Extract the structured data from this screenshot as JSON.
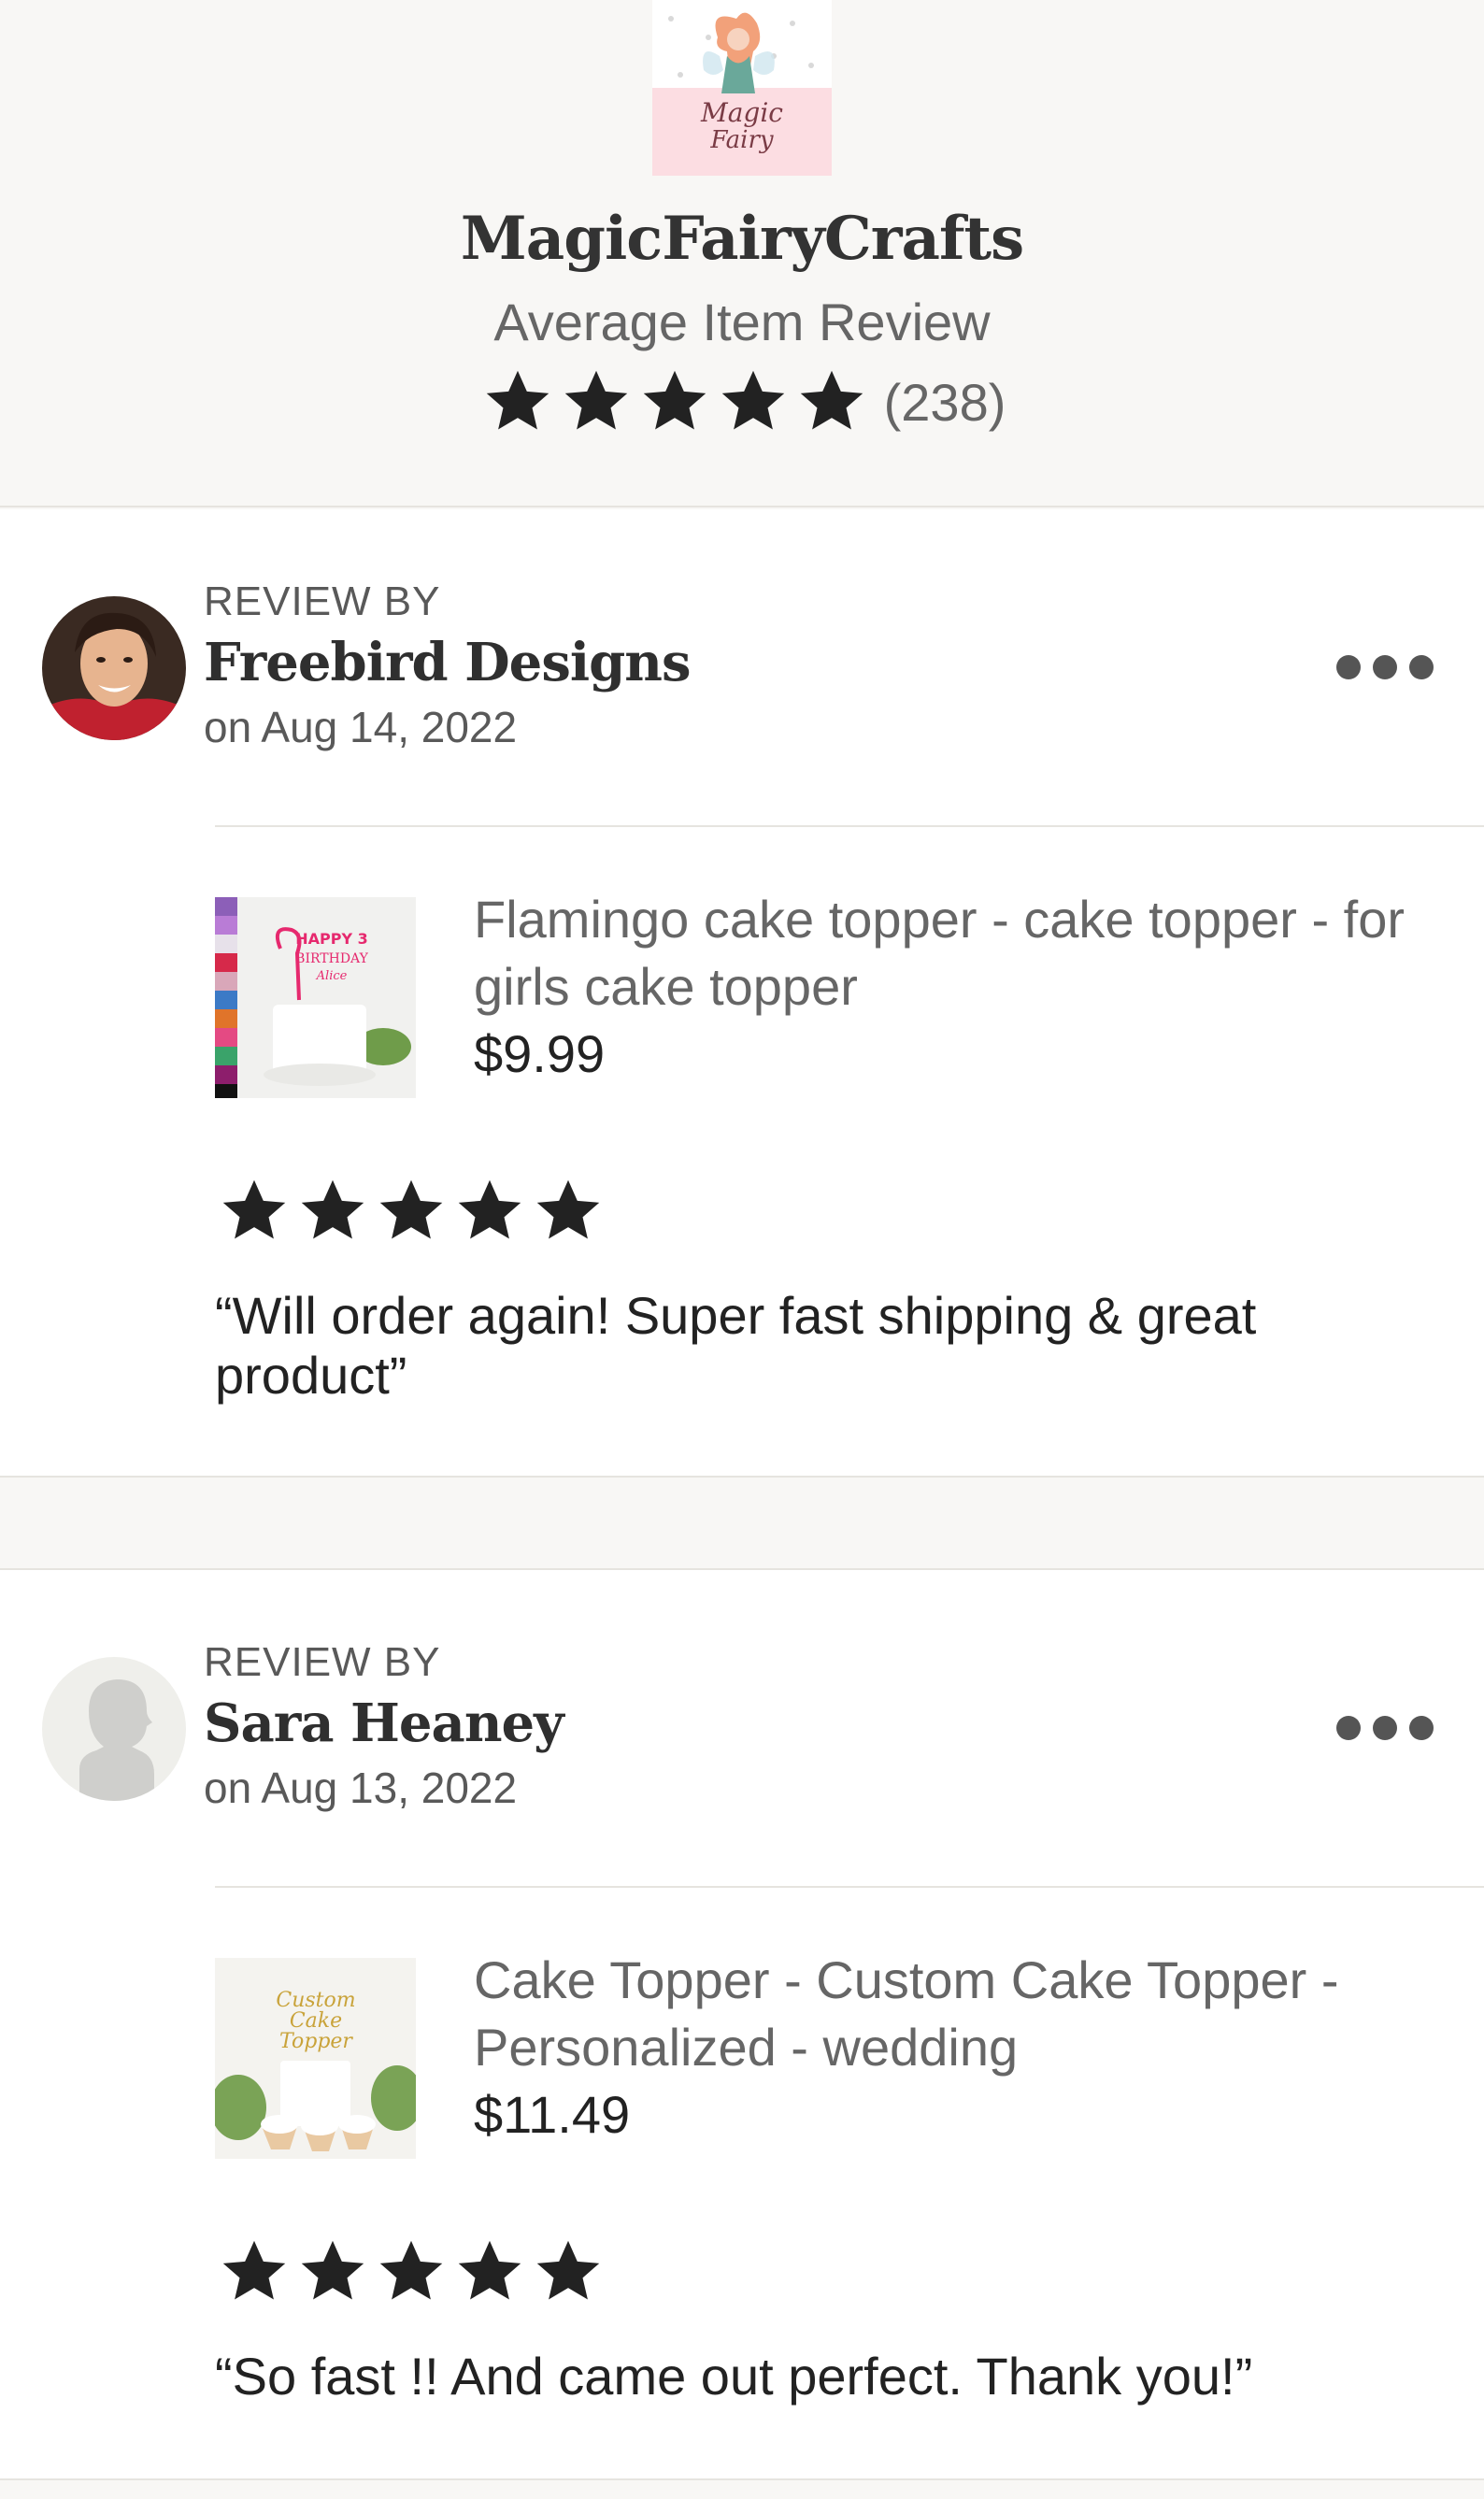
{
  "shop": {
    "name": "MagicFairyCrafts",
    "logo_text": "Magic Fairy",
    "average_label": "Average Item Review",
    "rating": 5,
    "review_count": "(238)"
  },
  "reviews": [
    {
      "review_by_label": "REVIEW BY",
      "reviewer": "Freebird Designs",
      "date": "on Aug 14, 2022",
      "avatar_icon": "reviewer-photo",
      "item_title": "Flamingo cake topper - cake topper - for girls cake topper",
      "item_price": "$9.99",
      "item_thumb_text": "HAPPY 3 BIRTHDAY Alice",
      "rating": 5,
      "text": "“Will order again! Super fast shipping & great product”"
    },
    {
      "review_by_label": "REVIEW BY",
      "reviewer": "Sara Heaney",
      "date": "on Aug 13, 2022",
      "avatar_icon": "default-user-icon",
      "item_title": "Cake Topper - Custom Cake Topper - Personalized - wedding",
      "item_price": "$11.49",
      "item_thumb_text": "Custom Cake Topper",
      "rating": 5,
      "text": "“So fast !! And came out perfect. Thank you!”"
    }
  ],
  "colors": {
    "star": "#222222",
    "muted_text": "#666666",
    "background": "#f8f7f5"
  }
}
